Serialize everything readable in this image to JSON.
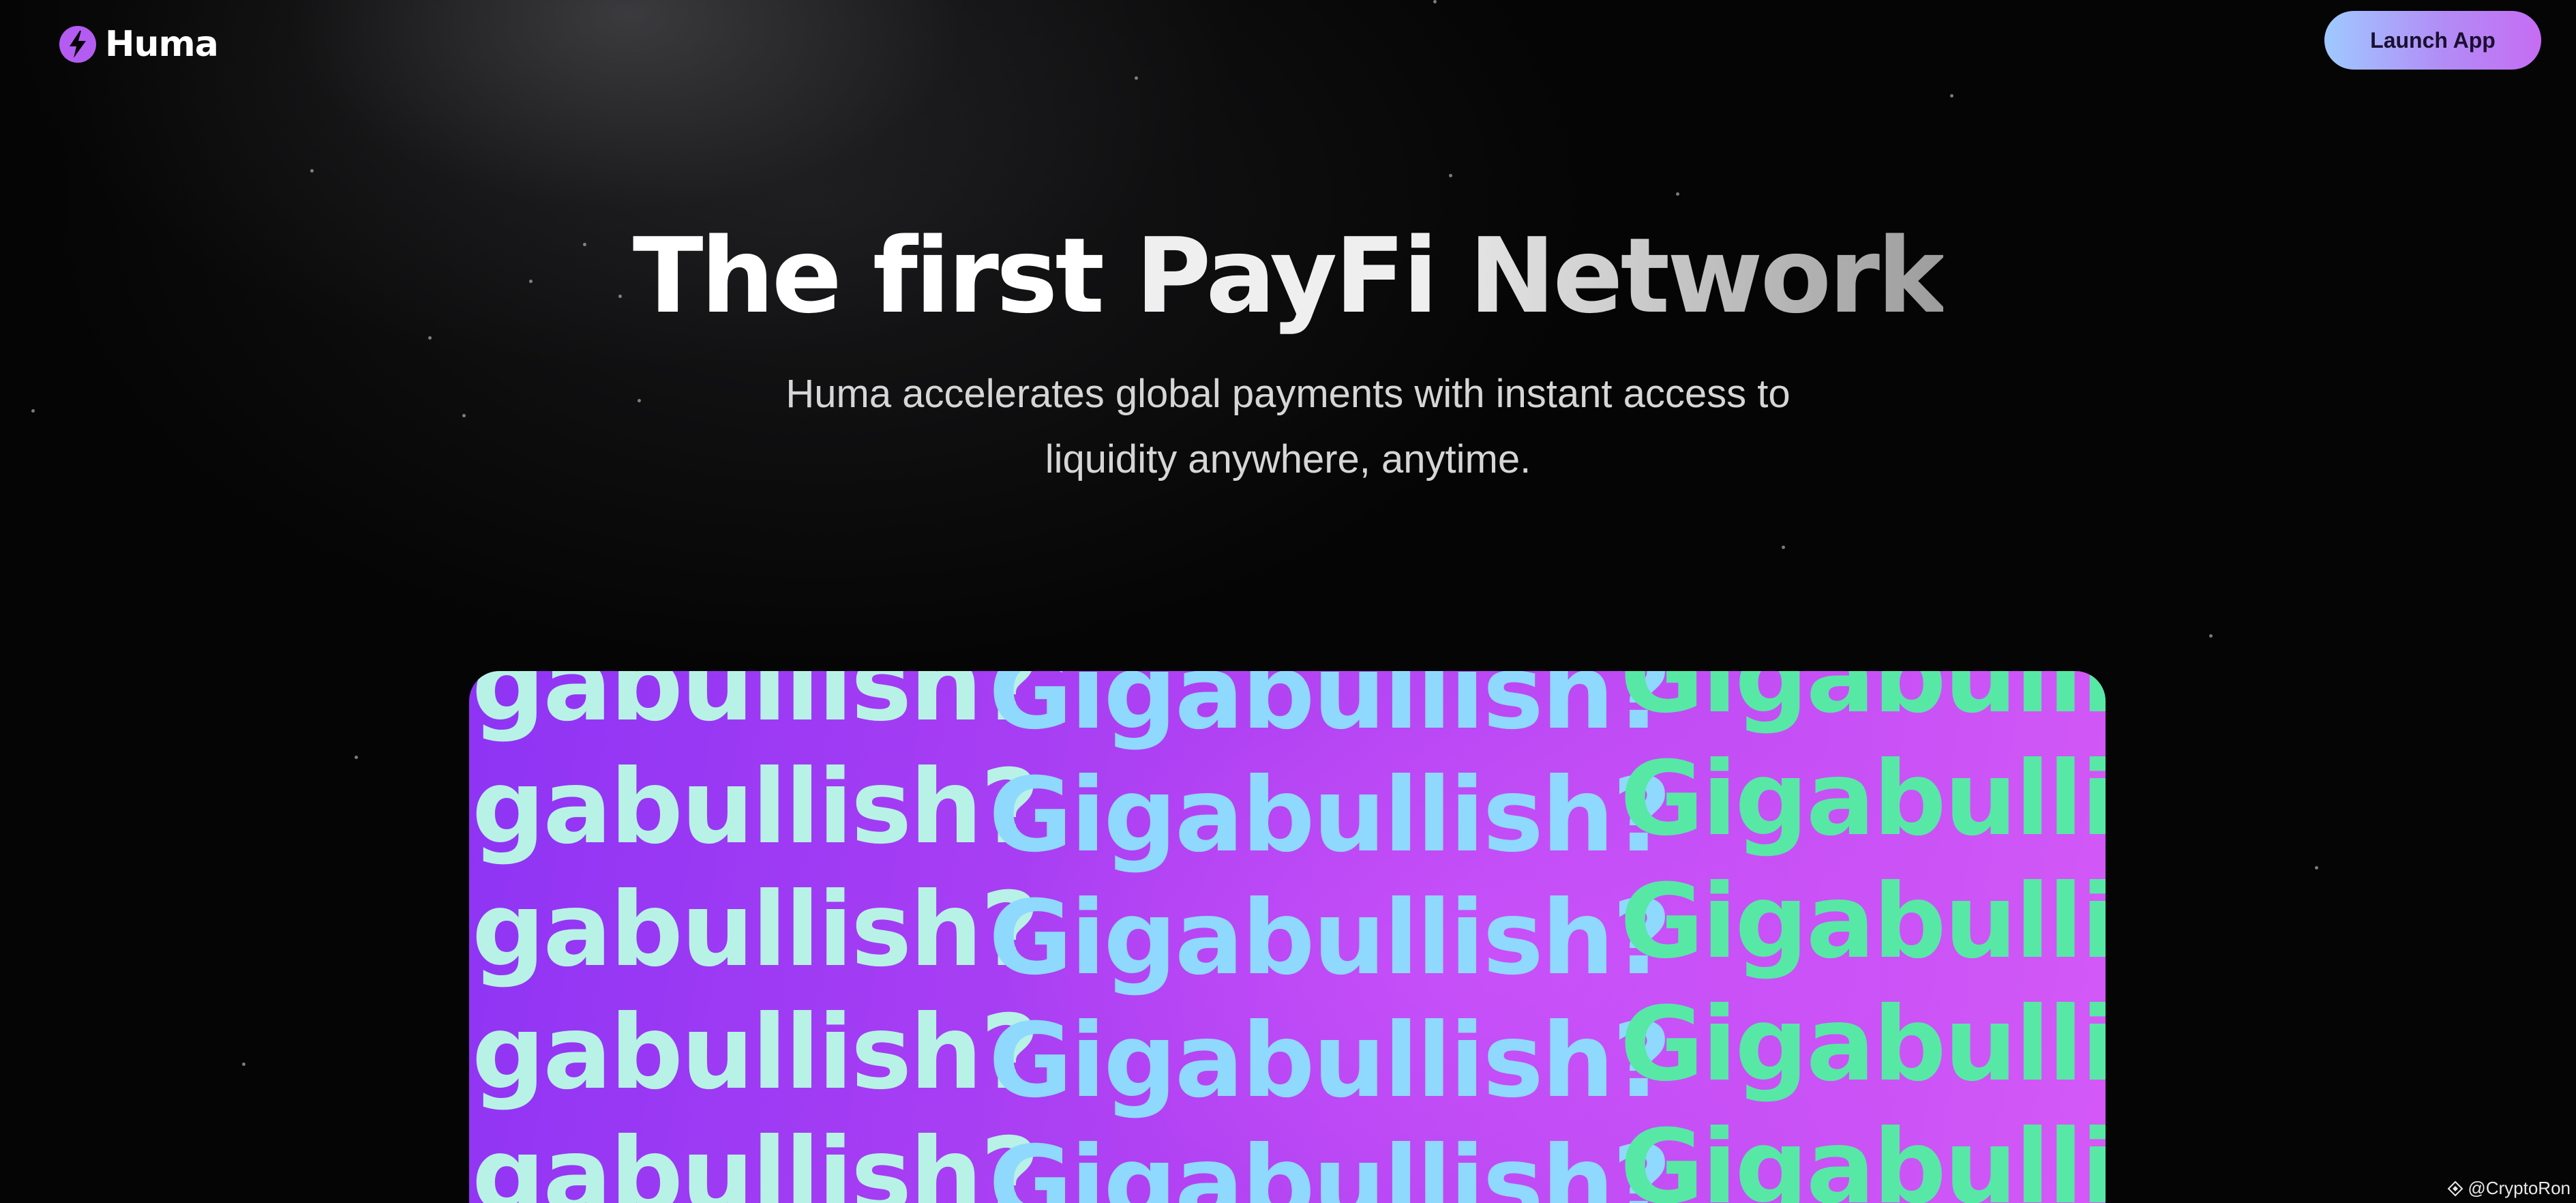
{
  "header": {
    "logo_text": "Huma",
    "launch_button_label": "Launch App"
  },
  "hero": {
    "title_part1": "The first ",
    "title_part2": "PayFi ",
    "title_part3": "Network",
    "subtitle_line1": "Huma accelerates global payments with instant access to",
    "subtitle_line2": "liquidity anywhere, anytime."
  },
  "banner": {
    "rows": [
      {
        "col1": "gabullish?",
        "col2": "Gigabullish?",
        "col3": "Gigabullis"
      },
      {
        "col1": "gabullish?",
        "col2": "Gigabullish?",
        "col3": "Gigabullis"
      },
      {
        "col1": "gabullish?",
        "col2": "Gigabullish?",
        "col3": "Gigabullis"
      },
      {
        "col1": "gabullish?",
        "col2": "Gigabullish?",
        "col3": "Gigabullis"
      },
      {
        "col1": "gabullish?",
        "col2": "Gigabullish?",
        "col3": "Gigabullis"
      }
    ]
  },
  "watermark": {
    "text": "@CryptoRon"
  },
  "icons": {
    "logo": "lightning-bolt-icon",
    "watermark": "binance-diamond-icon"
  },
  "colors": {
    "background": "#050505",
    "button_gradient_start": "#9fc9ff",
    "button_gradient_end": "#c66cf3",
    "banner_purple": "#b142f3",
    "banner_text_mint": "#b8f2e6",
    "banner_text_sky": "#8fd9ff",
    "banner_text_green": "#57e8a6"
  }
}
